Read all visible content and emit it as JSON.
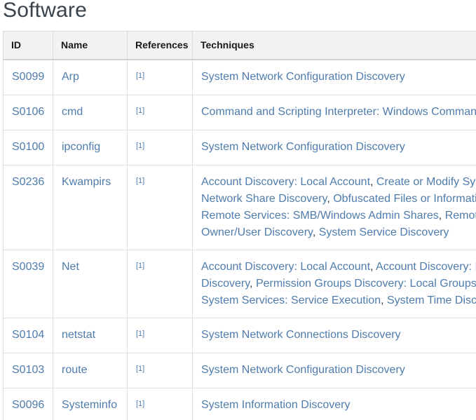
{
  "section_title": "Software",
  "table": {
    "headers": {
      "id": "ID",
      "name": "Name",
      "references": "References",
      "techniques": "Techniques"
    },
    "rows": [
      {
        "id": "S0099",
        "name": "Arp",
        "ref": "[1]",
        "lines": [
          [
            "System Network Configuration Discovery"
          ]
        ]
      },
      {
        "id": "S0106",
        "name": "cmd",
        "ref": "[1]",
        "lines": [
          [
            "Command and Scripting Interpreter: Windows Comman"
          ]
        ]
      },
      {
        "id": "S0100",
        "name": "ipconfig",
        "ref": "[1]",
        "lines": [
          [
            "System Network Configuration Discovery"
          ]
        ]
      },
      {
        "id": "S0236",
        "name": "Kwampirs",
        "ref": "[1]",
        "lines": [
          [
            "Account Discovery: Local Account",
            "Create or Modify Sys"
          ],
          [
            "Network Share Discovery",
            "Obfuscated Files or Informati"
          ],
          [
            "Remote Services: SMB/Windows Admin Shares",
            "Remote"
          ],
          [
            "Owner/User Discovery",
            "System Service Discovery"
          ]
        ]
      },
      {
        "id": "S0039",
        "name": "Net",
        "ref": "[1]",
        "lines": [
          [
            "Account Discovery: Local Account",
            "Account Discovery: I"
          ],
          [
            "Discovery",
            "Permission Groups Discovery: Local Groups",
            ""
          ],
          [
            "System Services: Service Execution",
            "System Time Disco"
          ]
        ]
      },
      {
        "id": "S0104",
        "name": "netstat",
        "ref": "[1]",
        "lines": [
          [
            "System Network Connections Discovery"
          ]
        ]
      },
      {
        "id": "S0103",
        "name": "route",
        "ref": "[1]",
        "lines": [
          [
            "System Network Configuration Discovery"
          ]
        ]
      },
      {
        "id": "S0096",
        "name": "Systeminfo",
        "ref": "[1]",
        "lines": [
          [
            "System Information Discovery"
          ]
        ]
      }
    ]
  },
  "colors": {
    "link": "#4f7cac",
    "text": "#39434c",
    "header_bg": "#f2f2f2"
  }
}
